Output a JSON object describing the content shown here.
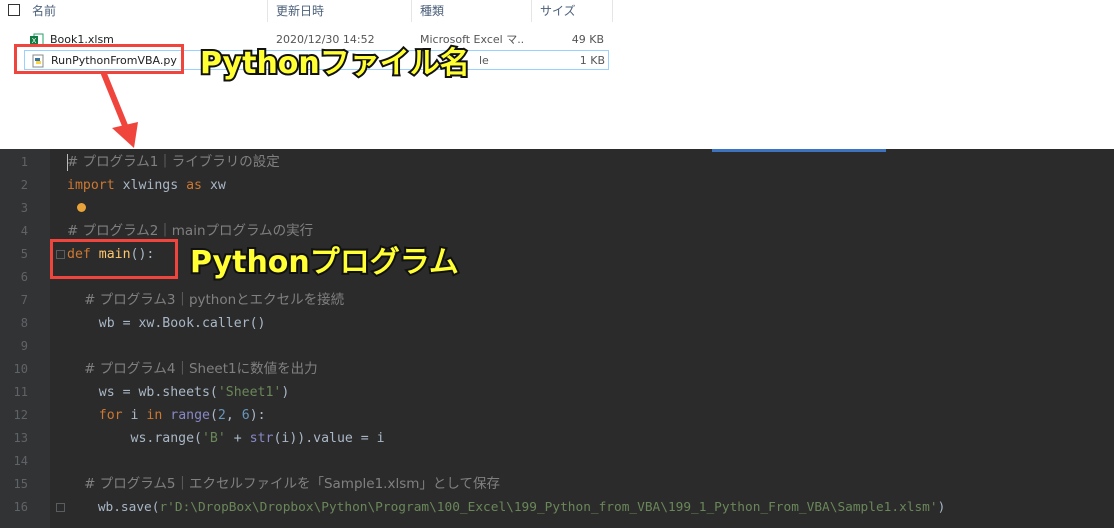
{
  "explorer": {
    "columns": [
      "名前",
      "更新日時",
      "種類",
      "サイズ"
    ],
    "files": [
      {
        "name": "Book1.xlsm",
        "date": "2020/12/30 14:52",
        "type": "Microsoft Excel マ...",
        "size": "49 KB",
        "icon": "excel-file-icon"
      },
      {
        "name": "RunPythonFromVBA.py",
        "date": "",
        "type": "le",
        "size": "1 KB",
        "icon": "python-file-icon"
      }
    ]
  },
  "annotations": {
    "filename_label": "Pythonファイル名",
    "program_label": "Pythonプログラム"
  },
  "editor": {
    "lines": [
      {
        "n": "1",
        "t": "# プログラム1｜ライブラリの設定"
      },
      {
        "n": "2",
        "t": "import xlwings as xw"
      },
      {
        "n": "3",
        "t": ""
      },
      {
        "n": "4",
        "t": "# プログラム2｜mainプログラムの実行"
      },
      {
        "n": "5",
        "t": "def main():"
      },
      {
        "n": "6",
        "t": ""
      },
      {
        "n": "7",
        "t": "    # プログラム3｜pythonとエクセルを接続"
      },
      {
        "n": "8",
        "t": "    wb = xw.Book.caller()"
      },
      {
        "n": "9",
        "t": ""
      },
      {
        "n": "10",
        "t": "    # プログラム4｜Sheet1に数値を出力"
      },
      {
        "n": "11",
        "t": "    ws = wb.sheets('Sheet1')"
      },
      {
        "n": "12",
        "t": "    for i in range(2, 6):"
      },
      {
        "n": "13",
        "t": "        ws.range('B' + str(i)).value = i"
      },
      {
        "n": "14",
        "t": ""
      },
      {
        "n": "15",
        "t": "    # プログラム5｜エクセルファイルを「Sample1.xlsm」として保存"
      },
      {
        "n": "16",
        "t": "    wb.save(r'D:\\DropBox\\Dropbox\\Python\\Program\\100_Excel\\199_Python_from_VBA\\199_1_Python_From_VBA\\Sample1.xlsm')"
      }
    ]
  },
  "colors": {
    "editor_bg": "#2b2b2b",
    "annotation_fill": "#ffff33",
    "highlight_box": "#f0453d"
  }
}
